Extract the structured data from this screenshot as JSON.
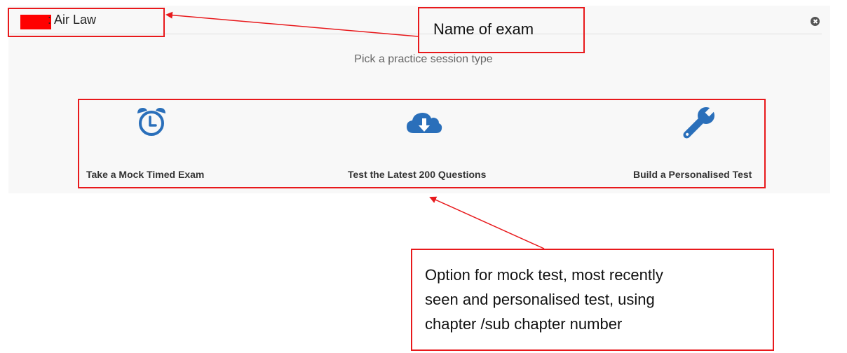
{
  "header": {
    "title": ": Air Law"
  },
  "subtitle": "Pick a practice session type",
  "options": [
    {
      "label": "Take a Mock Timed Exam",
      "icon": "alarm-clock-icon"
    },
    {
      "label": "Test the Latest 200 Questions",
      "icon": "cloud-download-icon"
    },
    {
      "label": "Build a Personalised Test",
      "icon": "wrench-icon"
    }
  ],
  "colors": {
    "accent": "#2a6fba",
    "annotation": "#e8191c",
    "panel": "#f8f8f8"
  },
  "annotations": {
    "exam_name": "Name of exam",
    "options_line1": "Option for mock test, most recently",
    "options_line2": "seen and personalised test, using",
    "options_line3": "chapter /sub chapter number"
  }
}
